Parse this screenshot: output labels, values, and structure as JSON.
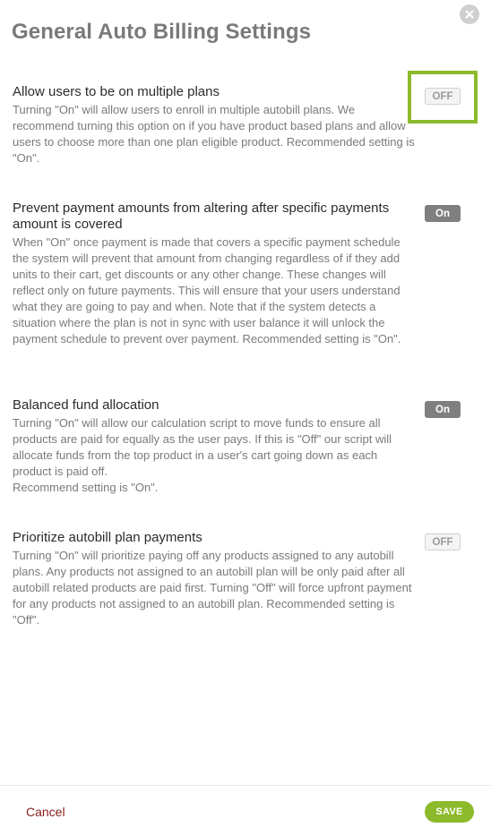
{
  "dialog": {
    "title": "General Auto Billing Settings",
    "close_icon": "close-icon"
  },
  "settings": [
    {
      "label": "Allow users to be on multiple plans",
      "description": "Turning \"On\" will allow users to enroll in multiple autobill plans. We recommend turning this option on if you have product based plans and allow users to choose more than one plan eligible product. Recommended setting is \"On\".",
      "toggle": "OFF",
      "state": "off"
    },
    {
      "label": "Prevent payment amounts from altering after specific payments amount is covered",
      "description": "When \"On\" once payment is made that covers a specific payment schedule the system will prevent that amount from changing regardless of if they add units to their cart, get discounts or any other change. These changes will reflect only on future payments. This will ensure that your users understand what they are going to pay and when. Note that if the system detects a situation where the plan is not in sync with user balance it will unlock the payment schedule to prevent over payment. Recommended setting is \"On\".",
      "toggle": "On",
      "state": "on"
    },
    {
      "label": "Balanced fund allocation",
      "description": "Turning \"On\" will allow our calculation script to move funds to ensure all products are paid for equally as the user pays. If this is \"Off\" our script will allocate funds from the top product in a user's cart going down as each product is paid off.",
      "description_extra": "Recommend setting is \"On\".",
      "toggle": "On",
      "state": "on"
    },
    {
      "label": "Prioritize autobill plan payments",
      "description": "Turning \"On\" will prioritize paying off any products assigned to any autobill plans. Any products not assigned to an autobill plan will be only paid after all autobill related products are paid first. Turning \"Off\" will force upfront payment for any products not assigned to an autobill plan. Recommended setting is \"Off\".",
      "toggle": "OFF",
      "state": "off"
    }
  ],
  "footer": {
    "cancel_label": "Cancel",
    "save_label": "SAVE"
  },
  "colors": {
    "accent": "#8cba2b",
    "cancel": "#8b1d1d",
    "toggle_on": "#7f7f7f",
    "toggle_off": "#f4f4f4"
  }
}
